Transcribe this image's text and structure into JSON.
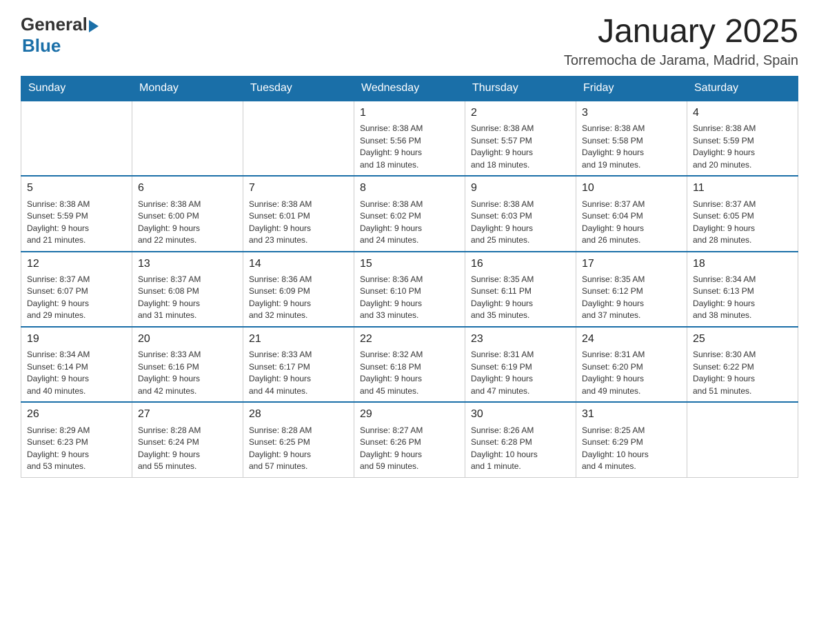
{
  "header": {
    "logo": {
      "general": "General",
      "blue": "Blue",
      "aria": "GeneralBlue logo"
    },
    "title": "January 2025",
    "location": "Torremocha de Jarama, Madrid, Spain"
  },
  "calendar": {
    "days_of_week": [
      "Sunday",
      "Monday",
      "Tuesday",
      "Wednesday",
      "Thursday",
      "Friday",
      "Saturday"
    ],
    "weeks": [
      [
        {
          "day": "",
          "info": ""
        },
        {
          "day": "",
          "info": ""
        },
        {
          "day": "",
          "info": ""
        },
        {
          "day": "1",
          "info": "Sunrise: 8:38 AM\nSunset: 5:56 PM\nDaylight: 9 hours\nand 18 minutes."
        },
        {
          "day": "2",
          "info": "Sunrise: 8:38 AM\nSunset: 5:57 PM\nDaylight: 9 hours\nand 18 minutes."
        },
        {
          "day": "3",
          "info": "Sunrise: 8:38 AM\nSunset: 5:58 PM\nDaylight: 9 hours\nand 19 minutes."
        },
        {
          "day": "4",
          "info": "Sunrise: 8:38 AM\nSunset: 5:59 PM\nDaylight: 9 hours\nand 20 minutes."
        }
      ],
      [
        {
          "day": "5",
          "info": "Sunrise: 8:38 AM\nSunset: 5:59 PM\nDaylight: 9 hours\nand 21 minutes."
        },
        {
          "day": "6",
          "info": "Sunrise: 8:38 AM\nSunset: 6:00 PM\nDaylight: 9 hours\nand 22 minutes."
        },
        {
          "day": "7",
          "info": "Sunrise: 8:38 AM\nSunset: 6:01 PM\nDaylight: 9 hours\nand 23 minutes."
        },
        {
          "day": "8",
          "info": "Sunrise: 8:38 AM\nSunset: 6:02 PM\nDaylight: 9 hours\nand 24 minutes."
        },
        {
          "day": "9",
          "info": "Sunrise: 8:38 AM\nSunset: 6:03 PM\nDaylight: 9 hours\nand 25 minutes."
        },
        {
          "day": "10",
          "info": "Sunrise: 8:37 AM\nSunset: 6:04 PM\nDaylight: 9 hours\nand 26 minutes."
        },
        {
          "day": "11",
          "info": "Sunrise: 8:37 AM\nSunset: 6:05 PM\nDaylight: 9 hours\nand 28 minutes."
        }
      ],
      [
        {
          "day": "12",
          "info": "Sunrise: 8:37 AM\nSunset: 6:07 PM\nDaylight: 9 hours\nand 29 minutes."
        },
        {
          "day": "13",
          "info": "Sunrise: 8:37 AM\nSunset: 6:08 PM\nDaylight: 9 hours\nand 31 minutes."
        },
        {
          "day": "14",
          "info": "Sunrise: 8:36 AM\nSunset: 6:09 PM\nDaylight: 9 hours\nand 32 minutes."
        },
        {
          "day": "15",
          "info": "Sunrise: 8:36 AM\nSunset: 6:10 PM\nDaylight: 9 hours\nand 33 minutes."
        },
        {
          "day": "16",
          "info": "Sunrise: 8:35 AM\nSunset: 6:11 PM\nDaylight: 9 hours\nand 35 minutes."
        },
        {
          "day": "17",
          "info": "Sunrise: 8:35 AM\nSunset: 6:12 PM\nDaylight: 9 hours\nand 37 minutes."
        },
        {
          "day": "18",
          "info": "Sunrise: 8:34 AM\nSunset: 6:13 PM\nDaylight: 9 hours\nand 38 minutes."
        }
      ],
      [
        {
          "day": "19",
          "info": "Sunrise: 8:34 AM\nSunset: 6:14 PM\nDaylight: 9 hours\nand 40 minutes."
        },
        {
          "day": "20",
          "info": "Sunrise: 8:33 AM\nSunset: 6:16 PM\nDaylight: 9 hours\nand 42 minutes."
        },
        {
          "day": "21",
          "info": "Sunrise: 8:33 AM\nSunset: 6:17 PM\nDaylight: 9 hours\nand 44 minutes."
        },
        {
          "day": "22",
          "info": "Sunrise: 8:32 AM\nSunset: 6:18 PM\nDaylight: 9 hours\nand 45 minutes."
        },
        {
          "day": "23",
          "info": "Sunrise: 8:31 AM\nSunset: 6:19 PM\nDaylight: 9 hours\nand 47 minutes."
        },
        {
          "day": "24",
          "info": "Sunrise: 8:31 AM\nSunset: 6:20 PM\nDaylight: 9 hours\nand 49 minutes."
        },
        {
          "day": "25",
          "info": "Sunrise: 8:30 AM\nSunset: 6:22 PM\nDaylight: 9 hours\nand 51 minutes."
        }
      ],
      [
        {
          "day": "26",
          "info": "Sunrise: 8:29 AM\nSunset: 6:23 PM\nDaylight: 9 hours\nand 53 minutes."
        },
        {
          "day": "27",
          "info": "Sunrise: 8:28 AM\nSunset: 6:24 PM\nDaylight: 9 hours\nand 55 minutes."
        },
        {
          "day": "28",
          "info": "Sunrise: 8:28 AM\nSunset: 6:25 PM\nDaylight: 9 hours\nand 57 minutes."
        },
        {
          "day": "29",
          "info": "Sunrise: 8:27 AM\nSunset: 6:26 PM\nDaylight: 9 hours\nand 59 minutes."
        },
        {
          "day": "30",
          "info": "Sunrise: 8:26 AM\nSunset: 6:28 PM\nDaylight: 10 hours\nand 1 minute."
        },
        {
          "day": "31",
          "info": "Sunrise: 8:25 AM\nSunset: 6:29 PM\nDaylight: 10 hours\nand 4 minutes."
        },
        {
          "day": "",
          "info": ""
        }
      ]
    ]
  }
}
